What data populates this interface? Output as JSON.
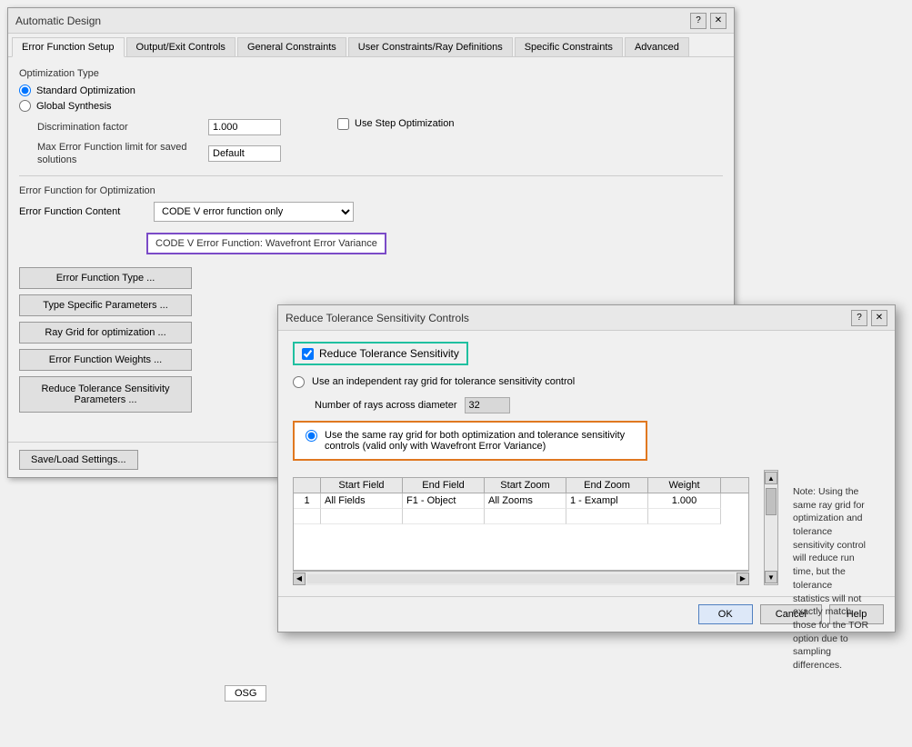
{
  "mainWindow": {
    "title": "Automatic Design",
    "tabs": [
      {
        "id": "error-function-setup",
        "label": "Error Function Setup",
        "active": true
      },
      {
        "id": "output-exit-controls",
        "label": "Output/Exit Controls"
      },
      {
        "id": "general-constraints",
        "label": "General Constraints"
      },
      {
        "id": "user-constraints",
        "label": "User Constraints/Ray Definitions"
      },
      {
        "id": "specific-constraints",
        "label": "Specific Constraints"
      },
      {
        "id": "advanced",
        "label": "Advanced"
      }
    ]
  },
  "optimizationType": {
    "label": "Optimization Type",
    "standardOpt": "Standard Optimization",
    "globalSynth": "Global Synthesis",
    "useStepOpt": "Use Step Optimization",
    "discriminationLabel": "Discrimination factor",
    "discriminationValue": "1.000",
    "maxErrorLabel": "Max Error Function limit for saved solutions",
    "maxErrorValue": "Default"
  },
  "errorFunction": {
    "sectionLabel": "Error Function for Optimization",
    "contentLabel": "Error Function Content",
    "contentValue": "CODE V error function only",
    "displayText": "CODE V Error Function: Wavefront Error Variance"
  },
  "buttons": {
    "errorFunctionType": "Error Function Type ...",
    "typeSpecificParams": "Type Specific Parameters ...",
    "rayGridForOpt": "Ray Grid for optimization ...",
    "errorFunctionWeights": "Error Function Weights ...",
    "reduceToleranceSensitivity": "Reduce Tolerance Sensitivity Parameters ..."
  },
  "bottomBar": {
    "saveLoad": "Save/Load Settings..."
  },
  "osg": "OSG",
  "dialog": {
    "title": "Reduce Tolerance Sensitivity Controls",
    "helpBtn": "?",
    "closeBtn": "✕",
    "checkboxLabel": "Reduce Tolerance Sensitivity",
    "radioOptions": [
      {
        "id": "independent-ray-grid",
        "label": "Use an independent ray grid for tolerance sensitivity control"
      },
      {
        "id": "same-ray-grid",
        "label": "Use the same ray grid for both optimization and tolerance sensitivity controls (valid only with Wavefront Error Variance)"
      }
    ],
    "raysLabel": "Number of rays across diameter",
    "raysValue": "32",
    "note": "Note: Using the same ray grid for optimization and tolerance sensitivity control will reduce run time, but the tolerance statistics will not exactly match those for the TOR option due to sampling differences.",
    "tableHeaders": [
      "",
      "Start Field",
      "End Field",
      "Start Zoom",
      "End Zoom",
      "Weight",
      ""
    ],
    "tableRows": [
      {
        "num": "1",
        "startField": "All Fields",
        "endField": "F1 - Object",
        "startZoom": "All Zooms",
        "endZoom": "1 - Exampl",
        "weight": "1.000"
      }
    ],
    "buttons": {
      "ok": "OK",
      "cancel": "Cancel",
      "help": "Help"
    }
  }
}
